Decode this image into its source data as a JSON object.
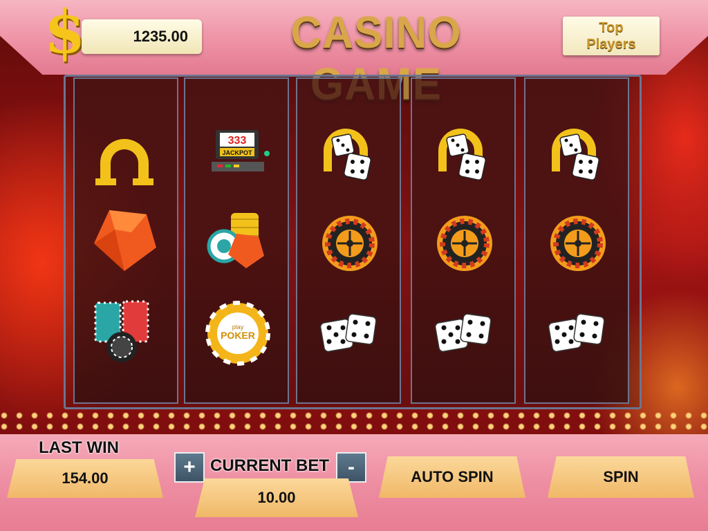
{
  "header": {
    "currency_symbol": "$",
    "balance": "1235.00",
    "title": "CASINO GAME",
    "top_players_line1": "Top",
    "top_players_line2": "Players"
  },
  "reels": [
    [
      "horseshoe-icon",
      "diamond-icon",
      "chip-stack-icon"
    ],
    [
      "jackpot-slot-machine-icon",
      "chips-and-diamond-icon",
      "poker-chip-icon"
    ],
    [
      "horseshoe-dice-icon",
      "roulette-wheel-icon",
      "dice-pair-icon"
    ],
    [
      "horseshoe-dice-icon",
      "roulette-wheel-icon",
      "dice-pair-icon"
    ],
    [
      "horseshoe-dice-icon",
      "roulette-wheel-icon",
      "dice-pair-icon"
    ]
  ],
  "symbols": {
    "jackpot_digits": "333",
    "jackpot_text": "JACKPOT",
    "chip_small_text": "play",
    "chip_large_text": "POKER"
  },
  "footer": {
    "last_win_label": "LAST WIN",
    "last_win_value": "154.00",
    "plus_label": "+",
    "current_bet_label": "CURRENT BET",
    "minus_label": "-",
    "current_bet_value": "10.00",
    "auto_spin_label": "AUTO SPIN",
    "spin_label": "SPIN"
  },
  "colors": {
    "gold": "#f6c51c",
    "title_gold": "#d9a64a",
    "header_pink": "#ee8fa3",
    "plate": "#f0b868",
    "reel_border": "#6d7490"
  }
}
